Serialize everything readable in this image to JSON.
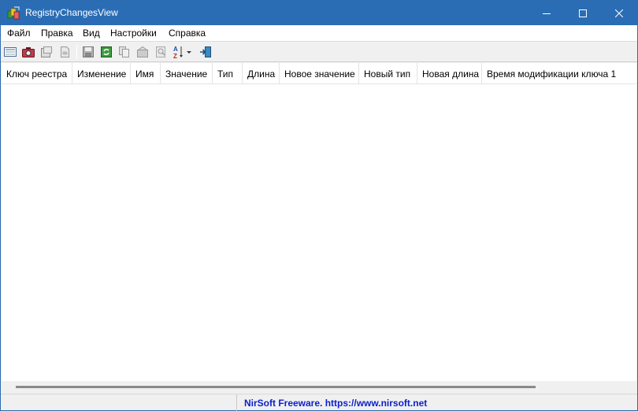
{
  "window": {
    "title": "RegistryChangesView",
    "controls": {
      "minimize": "minimize-icon",
      "maximize": "maximize-icon",
      "close": "close-icon"
    }
  },
  "menu": [
    "Файл",
    "Правка",
    "Вид",
    "Настройки",
    "Справка"
  ],
  "toolbar": {
    "tools": [
      "list-icon",
      "snapshot-icon",
      "open-snapshot-icon",
      "export-icon",
      "save-icon",
      "refresh-icon",
      "copy-icon",
      "properties-icon",
      "find-icon",
      "sort-icon",
      "exit-icon"
    ]
  },
  "columns": [
    "Ключ реестра",
    "Изменение",
    "Имя",
    "Значение",
    "Тип",
    "Длина",
    "Новое значение",
    "Новый тип",
    "Новая длина",
    "Время модификации ключа 1"
  ],
  "rows": [],
  "status": {
    "text": "NirSoft Freeware. https://www.nirsoft.net"
  },
  "colors": {
    "titlebar": "#2a6db5",
    "status_link": "#0a1fcc"
  }
}
